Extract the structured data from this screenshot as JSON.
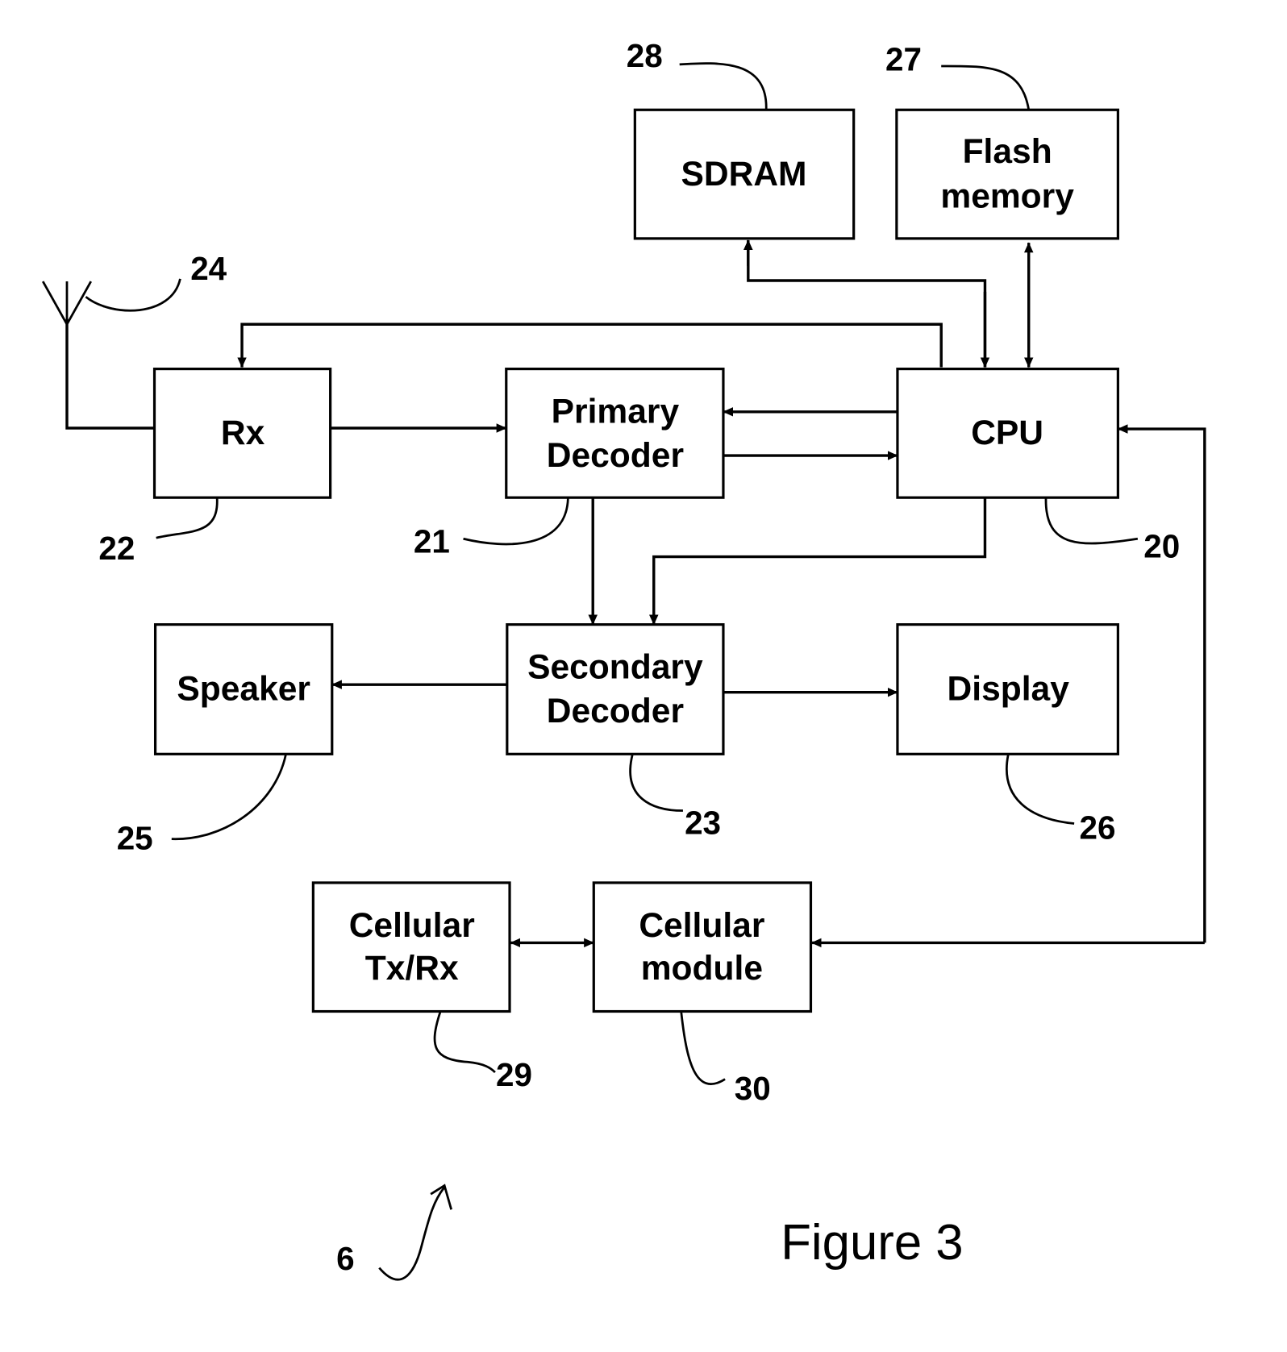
{
  "figure": {
    "caption": "Figure 3",
    "device_ref": "6"
  },
  "blocks": {
    "sdram": {
      "label": [
        "SDRAM"
      ],
      "ref": "28"
    },
    "flash": {
      "label": [
        "Flash",
        "memory"
      ],
      "ref": "27"
    },
    "rx": {
      "label": [
        "Rx"
      ],
      "ref": "22"
    },
    "primary_decoder": {
      "label": [
        "Primary",
        "Decoder"
      ],
      "ref": "21"
    },
    "cpu": {
      "label": [
        "CPU"
      ],
      "ref": "20"
    },
    "speaker": {
      "label": [
        "Speaker"
      ],
      "ref": "25"
    },
    "secondary_decoder": {
      "label": [
        "Secondary",
        "Decoder"
      ],
      "ref": "23"
    },
    "display": {
      "label": [
        "Display"
      ],
      "ref": "26"
    },
    "cellular_txrx": {
      "label": [
        "Cellular",
        "Tx/Rx"
      ],
      "ref": "29"
    },
    "cellular_module": {
      "label": [
        "Cellular",
        "module"
      ],
      "ref": "30"
    }
  },
  "antenna": {
    "ref": "24"
  },
  "connections": [
    {
      "from": "cpu",
      "to": "sdram",
      "direction": "bidirectional"
    },
    {
      "from": "cpu",
      "to": "flash",
      "direction": "bidirectional"
    },
    {
      "from": "cpu",
      "to": "rx",
      "direction": "to"
    },
    {
      "from": "antenna",
      "to": "rx",
      "direction": "none"
    },
    {
      "from": "rx",
      "to": "primary_decoder",
      "direction": "to"
    },
    {
      "from": "cpu",
      "to": "primary_decoder",
      "direction": "to"
    },
    {
      "from": "primary_decoder",
      "to": "cpu",
      "direction": "to"
    },
    {
      "from": "primary_decoder",
      "to": "secondary_decoder",
      "direction": "to"
    },
    {
      "from": "cpu",
      "to": "secondary_decoder",
      "direction": "to"
    },
    {
      "from": "secondary_decoder",
      "to": "speaker",
      "direction": "to"
    },
    {
      "from": "secondary_decoder",
      "to": "display",
      "direction": "to"
    },
    {
      "from": "cellular_txrx",
      "to": "cellular_module",
      "direction": "bidirectional"
    },
    {
      "from": "cellular_module",
      "to": "cpu",
      "direction": "bidirectional"
    }
  ]
}
